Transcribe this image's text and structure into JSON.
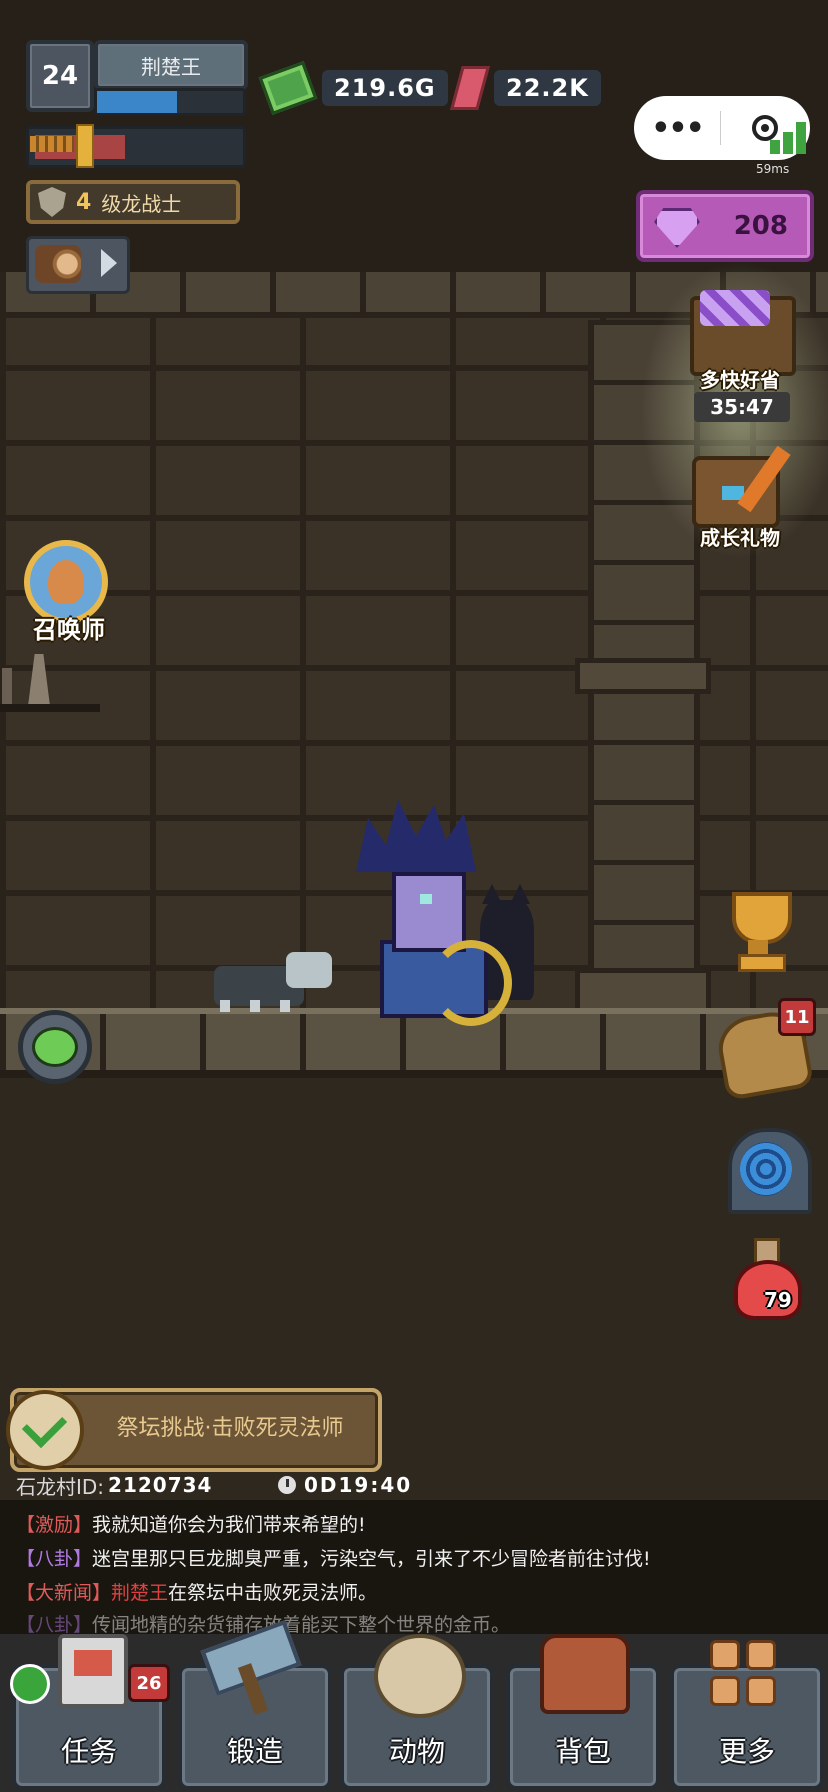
{
  "player": {
    "level": "24",
    "name": "荆楚王",
    "hp_fraction": 0.55,
    "xp_fraction": 0.45,
    "rank_level": "4",
    "rank_title": "级龙战士"
  },
  "currencies": {
    "gold": "219.6G",
    "ruby": "22.2K"
  },
  "capsule": {
    "more": "•••",
    "latency": "59ms"
  },
  "gem_shop": {
    "count": "208"
  },
  "events": {
    "deal_label": "多快好省",
    "deal_timer": "35:47",
    "growth_label": "成长礼物"
  },
  "summoner": {
    "label": "召唤师"
  },
  "side_icons": {
    "scroll_badge": "11",
    "potion_count": "79"
  },
  "quest": {
    "text": "祭坛挑战·击败死灵法师"
  },
  "village": {
    "id_label": "石龙村ID:",
    "id_value": "2120734",
    "timer": "0D19:40"
  },
  "chat": [
    {
      "tag": "【激励】",
      "tag_color": "#e05a5a",
      "text": "我就知道你会为我们带来希望的!"
    },
    {
      "tag": "【八卦】",
      "tag_color": "#b07ae0",
      "text": "迷宫里那只巨龙脚臭严重，污染空气，引来了不少冒险者前往讨伐!"
    },
    {
      "tag": "【大新闻】",
      "tag_color": "#e05a5a",
      "name": "荆楚王",
      "name_color": "#e04040",
      "text": "在祭坛中击败死灵法师。"
    },
    {
      "tag": "【八卦】",
      "tag_color": "#b07ae0",
      "text": "传闻地精的杂货铺存放着能买下整个世界的金币。"
    }
  ],
  "nav": {
    "task": "任务",
    "task_badge": "26",
    "forge": "锻造",
    "animal": "动物",
    "bag": "背包",
    "more": "更多"
  },
  "colors": {
    "gem_shop": "#b65ab8",
    "hp": "#3a86c8",
    "xp": "#a94444",
    "badge": "#c23a3a"
  }
}
